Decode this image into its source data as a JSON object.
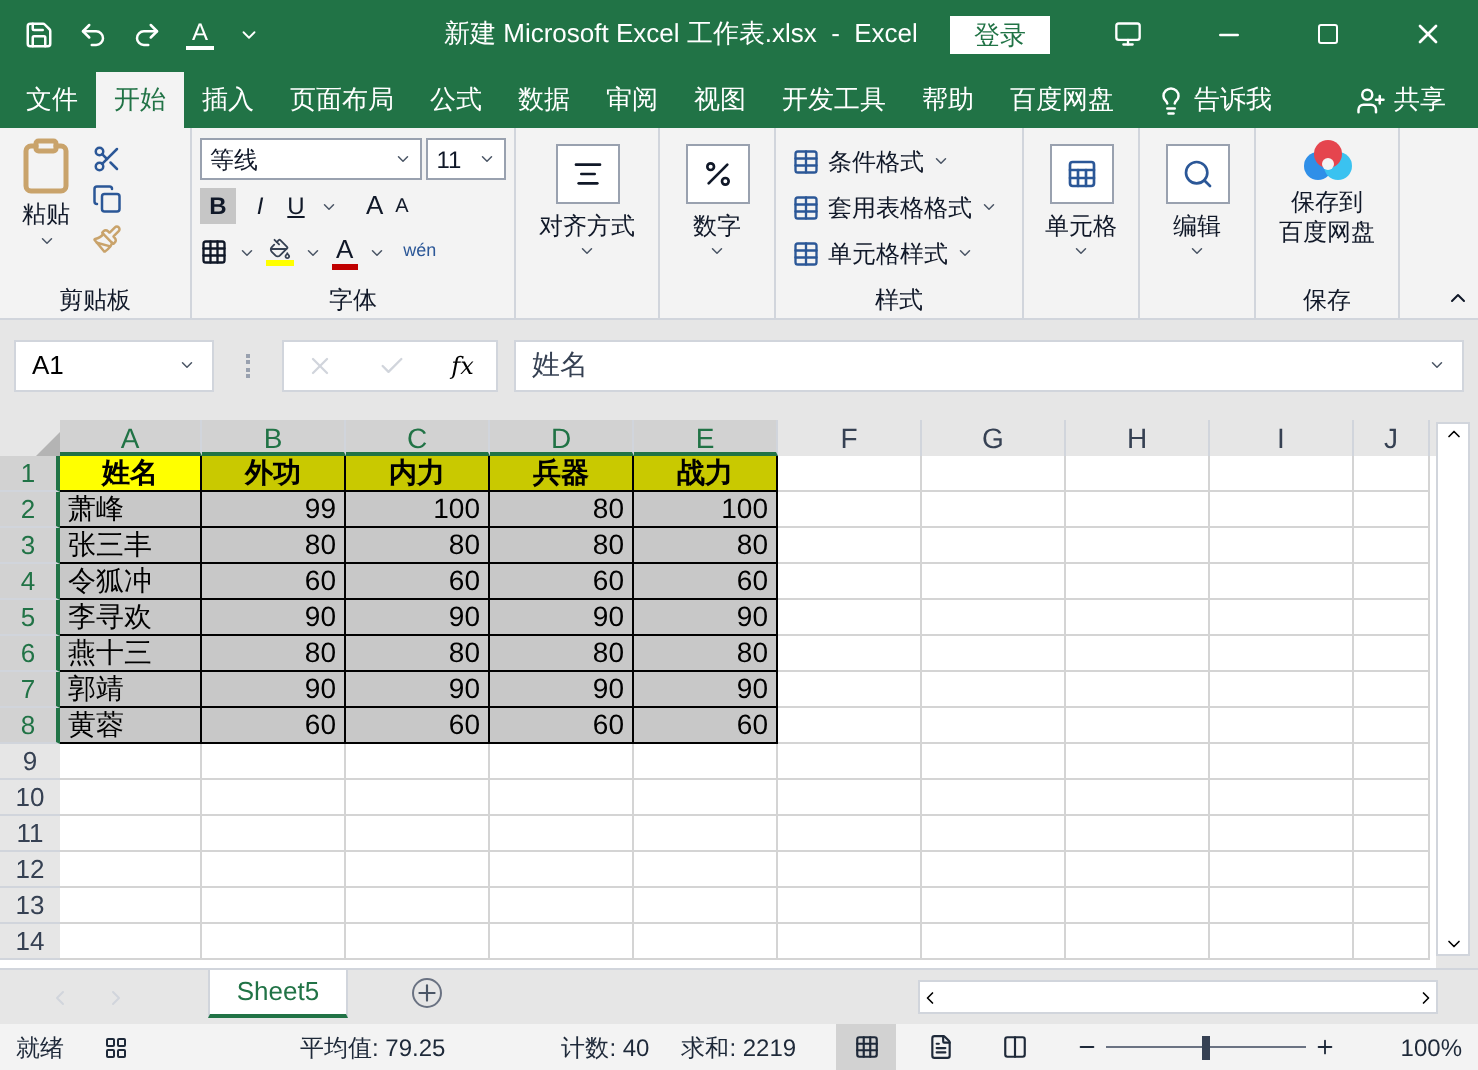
{
  "window": {
    "title": "新建 Microsoft Excel 工作表.xlsx  -  Excel",
    "login": "登录",
    "quick_font_color": "A"
  },
  "menu_tabs": [
    {
      "label": "文件",
      "selected": false
    },
    {
      "label": "开始",
      "selected": true
    },
    {
      "label": "插入",
      "selected": false
    },
    {
      "label": "页面布局",
      "selected": false
    },
    {
      "label": "公式",
      "selected": false
    },
    {
      "label": "数据",
      "selected": false
    },
    {
      "label": "审阅",
      "selected": false
    },
    {
      "label": "视图",
      "selected": false
    },
    {
      "label": "开发工具",
      "selected": false
    },
    {
      "label": "帮助",
      "selected": false
    },
    {
      "label": "百度网盘",
      "selected": false
    }
  ],
  "tell_me": "告诉我",
  "share": "共享",
  "ribbon": {
    "clipboard": {
      "paste": "粘贴",
      "label": "剪贴板"
    },
    "font": {
      "font_name": "等线",
      "font_size": "11",
      "label": "字体",
      "bold": "B",
      "italic": "I",
      "underline": "U",
      "grow": "A",
      "shrink": "A",
      "font_color": "A",
      "phonetic": "wén"
    },
    "alignment": {
      "button": "对齐方式"
    },
    "number": {
      "button": "数字"
    },
    "styles": {
      "items": [
        "条件格式",
        "套用表格格式",
        "单元格样式"
      ],
      "label": "样式"
    },
    "cells": {
      "button": "单元格"
    },
    "editing": {
      "button": "编辑"
    },
    "save": {
      "button_lines": [
        "保存到",
        "百度网盘"
      ],
      "label": "保存"
    }
  },
  "formula_bar": {
    "name_box": "A1",
    "function_label": "fx",
    "value": "姓名"
  },
  "columns": [
    {
      "label": "A",
      "selected": true
    },
    {
      "label": "B",
      "selected": true
    },
    {
      "label": "C",
      "selected": true
    },
    {
      "label": "D",
      "selected": true
    },
    {
      "label": "E",
      "selected": true
    },
    {
      "label": "F",
      "selected": false
    },
    {
      "label": "G",
      "selected": false
    },
    {
      "label": "H",
      "selected": false
    },
    {
      "label": "I",
      "selected": false
    },
    {
      "label": "J",
      "selected": false
    }
  ],
  "rows": [
    {
      "number": "1",
      "selected": true,
      "cells": [
        {
          "text": "姓名",
          "kind": "header",
          "color": "#ffff00"
        },
        {
          "text": "外功",
          "kind": "header",
          "color": "#c9c900"
        },
        {
          "text": "内力",
          "kind": "header",
          "color": "#c9c900"
        },
        {
          "text": "兵器",
          "kind": "header",
          "color": "#c9c900"
        },
        {
          "text": "战力",
          "kind": "header",
          "color": "#c9c900"
        }
      ]
    },
    {
      "number": "2",
      "selected": true,
      "cells": [
        {
          "text": "萧峰",
          "kind": "name",
          "color": "#c8c8c8"
        },
        {
          "text": "99",
          "kind": "number",
          "color": "#c8c8c8"
        },
        {
          "text": "100",
          "kind": "number",
          "color": "#c8c8c8"
        },
        {
          "text": "80",
          "kind": "number",
          "color": "#c8c8c8"
        },
        {
          "text": "100",
          "kind": "number",
          "color": "#c8c8c8"
        }
      ]
    },
    {
      "number": "3",
      "selected": true,
      "cells": [
        {
          "text": "张三丰",
          "kind": "name",
          "color": "#c8c8c8"
        },
        {
          "text": "80",
          "kind": "number",
          "color": "#c8c8c8"
        },
        {
          "text": "80",
          "kind": "number",
          "color": "#c8c8c8"
        },
        {
          "text": "80",
          "kind": "number",
          "color": "#c8c8c8"
        },
        {
          "text": "80",
          "kind": "number",
          "color": "#c8c8c8"
        }
      ]
    },
    {
      "number": "4",
      "selected": true,
      "cells": [
        {
          "text": "令狐冲",
          "kind": "name",
          "color": "#c8c8c8"
        },
        {
          "text": "60",
          "kind": "number",
          "color": "#c8c8c8"
        },
        {
          "text": "60",
          "kind": "number",
          "color": "#c8c8c8"
        },
        {
          "text": "60",
          "kind": "number",
          "color": "#c8c8c8"
        },
        {
          "text": "60",
          "kind": "number",
          "color": "#c8c8c8"
        }
      ]
    },
    {
      "number": "5",
      "selected": true,
      "cells": [
        {
          "text": "李寻欢",
          "kind": "name",
          "color": "#c8c8c8"
        },
        {
          "text": "90",
          "kind": "number",
          "color": "#c8c8c8"
        },
        {
          "text": "90",
          "kind": "number",
          "color": "#c8c8c8"
        },
        {
          "text": "90",
          "kind": "number",
          "color": "#c8c8c8"
        },
        {
          "text": "90",
          "kind": "number",
          "color": "#c8c8c8"
        }
      ]
    },
    {
      "number": "6",
      "selected": true,
      "cells": [
        {
          "text": "燕十三",
          "kind": "name",
          "color": "#c8c8c8"
        },
        {
          "text": "80",
          "kind": "number",
          "color": "#c8c8c8"
        },
        {
          "text": "80",
          "kind": "number",
          "color": "#c8c8c8"
        },
        {
          "text": "80",
          "kind": "number",
          "color": "#c8c8c8"
        },
        {
          "text": "80",
          "kind": "number",
          "color": "#c8c8c8"
        }
      ]
    },
    {
      "number": "7",
      "selected": true,
      "cells": [
        {
          "text": "郭靖",
          "kind": "name",
          "color": "#c8c8c8"
        },
        {
          "text": "90",
          "kind": "number",
          "color": "#c8c8c8"
        },
        {
          "text": "90",
          "kind": "number",
          "color": "#c8c8c8"
        },
        {
          "text": "90",
          "kind": "number",
          "color": "#c8c8c8"
        },
        {
          "text": "90",
          "kind": "number",
          "color": "#c8c8c8"
        }
      ]
    },
    {
      "number": "8",
      "selected": true,
      "cells": [
        {
          "text": "黄蓉",
          "kind": "name",
          "color": "#c8c8c8"
        },
        {
          "text": "60",
          "kind": "number",
          "color": "#c8c8c8"
        },
        {
          "text": "60",
          "kind": "number",
          "color": "#c8c8c8"
        },
        {
          "text": "60",
          "kind": "number",
          "color": "#c8c8c8"
        },
        {
          "text": "60",
          "kind": "number",
          "color": "#c8c8c8"
        }
      ]
    },
    {
      "number": "9",
      "selected": false,
      "cells": []
    },
    {
      "number": "10",
      "selected": false,
      "cells": []
    },
    {
      "number": "11",
      "selected": false,
      "cells": []
    },
    {
      "number": "12",
      "selected": false,
      "cells": []
    },
    {
      "number": "13",
      "selected": false,
      "cells": []
    },
    {
      "number": "14",
      "selected": false,
      "cells": []
    }
  ],
  "sheet_tabs": [
    {
      "label": "Sheet5",
      "selected": true
    }
  ],
  "status_bar": {
    "mode": "就绪",
    "average": "平均值: 79.25",
    "count": "计数: 40",
    "sum": "求和: 2219",
    "zoom": "100%",
    "zoom_slider": {
      "level": 0.5
    }
  }
}
